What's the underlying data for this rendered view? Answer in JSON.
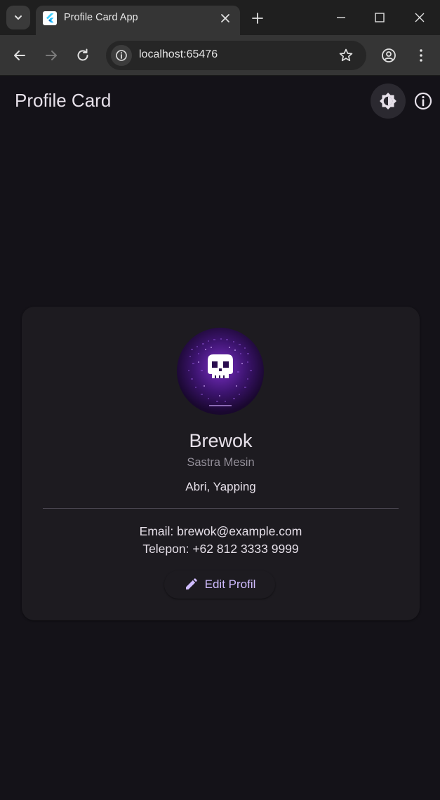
{
  "browser": {
    "tab_title": "Profile Card App",
    "url": "localhost:65476"
  },
  "app": {
    "title": "Profile Card"
  },
  "profile": {
    "name": "Brewok",
    "role": "Sastra Mesin",
    "hobbies": "Abri, Yapping",
    "email": "Email: brewok@example.com",
    "phone": "Telepon: +62 812 3333 9999"
  },
  "actions": {
    "edit_label": "Edit Profil"
  },
  "colors": {
    "background": "#141218",
    "card": "#1d1b20",
    "accent": "#d0bcff",
    "text": "#e6e0e9",
    "muted": "#938f99"
  },
  "icons": [
    "tab-list-icon",
    "flutter-favicon-icon",
    "close-icon",
    "plus-icon",
    "minimize-icon",
    "maximize-icon",
    "window-close-icon",
    "back-icon",
    "forward-icon",
    "reload-icon",
    "site-info-icon",
    "star-icon",
    "account-icon",
    "menu-icon",
    "brightness-icon",
    "info-icon",
    "pencil-icon"
  ]
}
